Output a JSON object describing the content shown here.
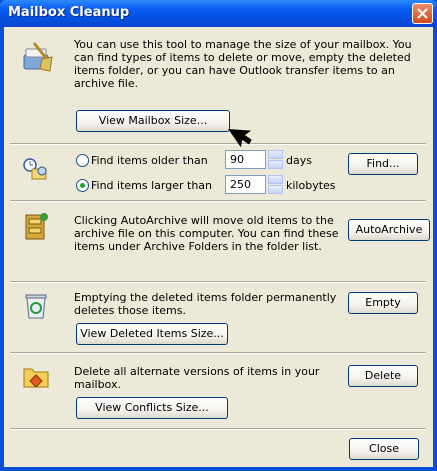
{
  "window": {
    "title": "Mailbox Cleanup"
  },
  "mailbox_size": {
    "description": "You can use this tool to manage the size of your mailbox. You can find types of items to delete or move, empty the deleted items folder, or you can have Outlook transfer items to an archive file.",
    "button_label": "View Mailbox Size..."
  },
  "find": {
    "older_label": "Find items older than",
    "older_value": "90",
    "older_unit": "days",
    "larger_label": "Find items larger than",
    "larger_value": "250",
    "larger_unit": "kilobytes",
    "selected": "larger",
    "button_label": "Find..."
  },
  "autoarchive": {
    "description": "Clicking AutoArchive will move old items to the archive file on this computer.  You can find these items under Archive Folders in the folder list.",
    "button_label": "AutoArchive"
  },
  "deleted_items": {
    "description": "Emptying the deleted items folder permanently deletes those items.",
    "size_button_label": "View Deleted Items Size...",
    "empty_button_label": "Empty"
  },
  "conflicts": {
    "description": "Delete all alternate versions of items in your mailbox.",
    "size_button_label": "View Conflicts Size...",
    "delete_button_label": "Delete"
  },
  "footer": {
    "close_label": "Close"
  },
  "colors": {
    "titlebar": "#0a5bf0",
    "client_background": "#ece9d8",
    "close_button": "#d6481e"
  }
}
